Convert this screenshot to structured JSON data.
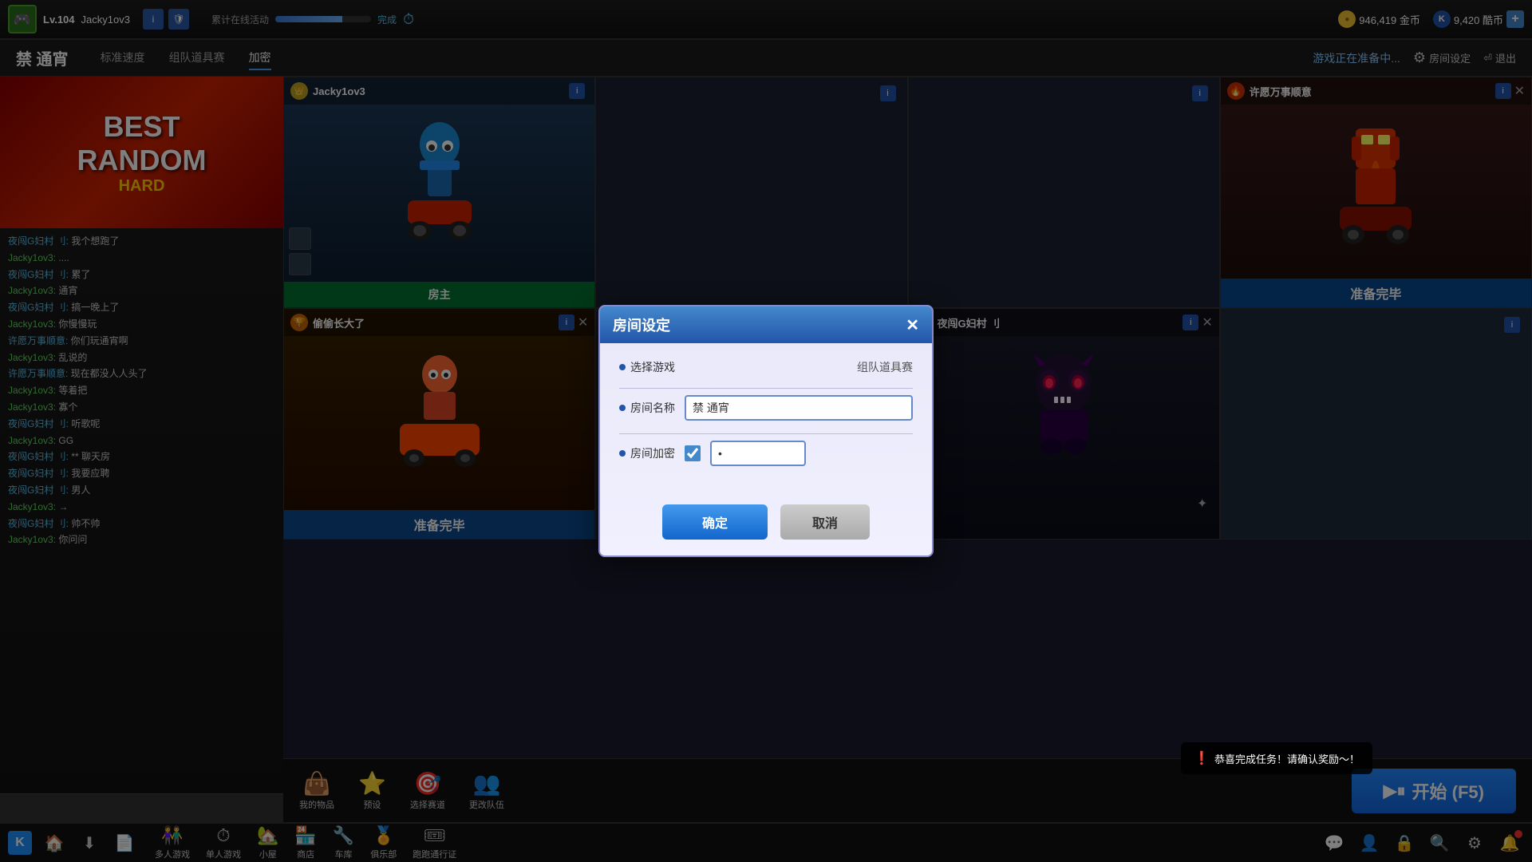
{
  "topbar": {
    "level": "Lv.104",
    "player_name": "Jacky1ov3",
    "info_icon": "i",
    "shield_icon": "🛡",
    "activity_label": "累计在线活动",
    "activity_status": "完成",
    "gold_amount": "946,419 金币",
    "kubi_amount": "9,420 酷币",
    "add_label": "+"
  },
  "secondary_nav": {
    "room_title": "禁 通宵",
    "tabs": [
      {
        "label": "标准速度",
        "active": false
      },
      {
        "label": "组队道具赛",
        "active": false
      },
      {
        "label": "加密",
        "active": true
      }
    ],
    "status": "游戏正在准备中...",
    "settings_label": "房间设定",
    "exit_label": "退出"
  },
  "slots": [
    {
      "id": 1,
      "player": "Jacky1ov3",
      "has_player": true,
      "is_owner": true,
      "owner_label": "房主",
      "char_type": "blue_ninja",
      "ready_label": "",
      "is_ready": false
    },
    {
      "id": 2,
      "player": "",
      "has_player": false
    },
    {
      "id": 3,
      "player": "",
      "has_player": false
    },
    {
      "id": 4,
      "player": "许愿万事顺意",
      "has_player": true,
      "is_owner": false,
      "char_type": "red_robot",
      "ready_label": "准备完毕",
      "is_ready": true
    }
  ],
  "slots2": [
    {
      "id": 5,
      "player": "偷偷长大了",
      "has_player": true,
      "char_type": "red_char",
      "ready_label": "准备完毕",
      "is_ready": true
    },
    {
      "id": 6,
      "player": "",
      "has_player": false
    },
    {
      "id": 7,
      "player": "夜闯G妇村 刂",
      "has_player": true,
      "char_type": "dark_beast",
      "ready_label": "",
      "is_ready": false
    },
    {
      "id": 8,
      "player": "",
      "has_player": false
    }
  ],
  "chat": {
    "messages": [
      {
        "name": "夜闯G妇村 刂:",
        "name_class": "name",
        "text": " 我个想跑了"
      },
      {
        "name": "Jacky1ov3:",
        "name_class": "name green",
        "text": " ...."
      },
      {
        "name": "夜闯G妇村 刂:",
        "name_class": "name",
        "text": " 累了"
      },
      {
        "name": "Jacky1ov3:",
        "name_class": "name green",
        "text": " 通宵"
      },
      {
        "name": "夜闯G妇村 刂:",
        "name_class": "name",
        "text": " 搞一晚上了"
      },
      {
        "name": "Jacky1ov3:",
        "name_class": "name green",
        "text": " 你慢慢玩"
      },
      {
        "name": "许愿万事顺意:",
        "name_class": "name",
        "text": " 你们玩通宵啊"
      },
      {
        "name": "Jacky1ov3:",
        "name_class": "name green",
        "text": " 乱说的"
      },
      {
        "name": "许愿万事顺意:",
        "name_class": "name",
        "text": " 现在都没人人头了"
      },
      {
        "name": "Jacky1ov3:",
        "name_class": "name green",
        "text": " 等着把"
      },
      {
        "name": "Jacky1ov3:",
        "name_class": "name green",
        "text": " 寡个"
      },
      {
        "name": "夜闯G妇村 刂:",
        "name_class": "name",
        "text": " 听歌呢"
      },
      {
        "name": "Jacky1ov3:",
        "name_class": "name green",
        "text": " GG"
      },
      {
        "name": "夜闯G妇村 刂:",
        "name_class": "name",
        "text": " **  聊天房"
      },
      {
        "name": "夜闯G妇村 刂:",
        "name_class": "name",
        "text": " 我要应聘"
      },
      {
        "name": "夜闯G妇村 刂:",
        "name_class": "name",
        "text": " 男人"
      },
      {
        "name": "Jacky1ov3:",
        "name_class": "name green",
        "text": " →"
      },
      {
        "name": "夜闯G妇村 刂:",
        "name_class": "name",
        "text": " 帅不帅"
      },
      {
        "name": "Jacky1ov3:",
        "name_class": "name green",
        "text": " 你问问"
      }
    ]
  },
  "toolbar": {
    "items_label": "我的物品",
    "preset_label": "预设",
    "track_label": "选择赛道",
    "team_label": "更改队伍",
    "start_label": "开始 (F5)"
  },
  "taskbar": {
    "multiplayer_label": "多人游戏",
    "single_label": "单人游戏",
    "house_label": "小屋",
    "shop_label": "商店",
    "garage_label": "车库",
    "club_label": "俱乐部",
    "passport_label": "跑跑通行证"
  },
  "dialog": {
    "title": "房间设定",
    "game_label": "选择游戏",
    "game_type": "组队道具赛",
    "room_name_label": "房间名称",
    "room_name_value": "禁 通宵",
    "room_password_label": "房间加密",
    "password_value": "*",
    "confirm_label": "确定",
    "cancel_label": "取消"
  },
  "toast": {
    "message": "恭喜完成任务！请确认奖励～！"
  },
  "banner": {
    "line1": "BEST",
    "line2": "RANDOM",
    "line3": "HARD"
  }
}
